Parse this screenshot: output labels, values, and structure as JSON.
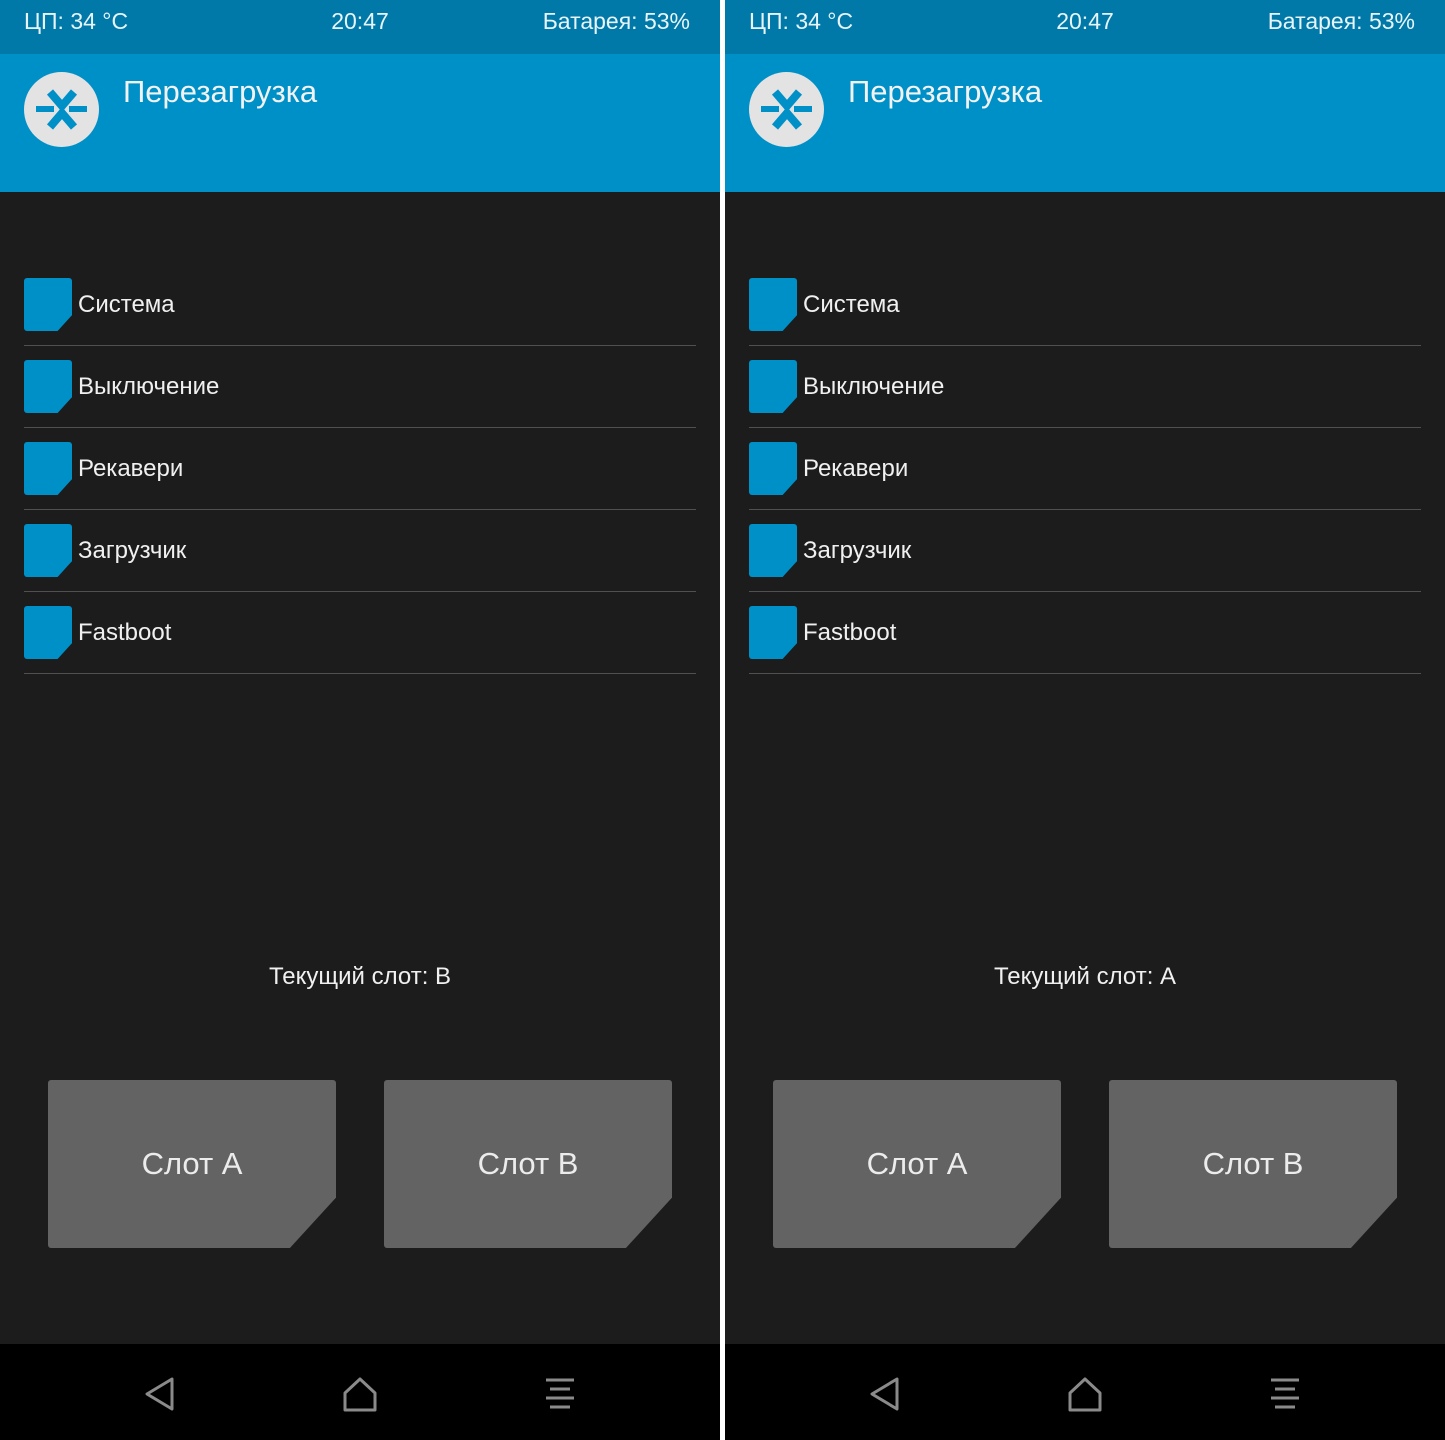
{
  "screens": [
    {
      "status": {
        "cpu": "ЦП: 34 °C",
        "time": "20:47",
        "battery": "Батарея: 53%"
      },
      "header": {
        "title": "Перезагрузка",
        "logo_icon": "twrp-logo-icon"
      },
      "menu": [
        {
          "label": "Система"
        },
        {
          "label": "Выключение"
        },
        {
          "label": "Рекавери"
        },
        {
          "label": "Загрузчик"
        },
        {
          "label": "Fastboot"
        }
      ],
      "current_slot": "Текущий слот: B",
      "slot_buttons": {
        "a": "Слот A",
        "b": "Слот B"
      },
      "nav": {
        "back_icon": "back-icon",
        "home_icon": "home-icon",
        "menu_icon": "menu-icon"
      }
    },
    {
      "status": {
        "cpu": "ЦП: 34 °C",
        "time": "20:47",
        "battery": "Батарея: 53%"
      },
      "header": {
        "title": "Перезагрузка",
        "logo_icon": "twrp-logo-icon"
      },
      "menu": [
        {
          "label": "Система"
        },
        {
          "label": "Выключение"
        },
        {
          "label": "Рекавери"
        },
        {
          "label": "Загрузчик"
        },
        {
          "label": "Fastboot"
        }
      ],
      "current_slot": "Текущий слот: A",
      "slot_buttons": {
        "a": "Слот A",
        "b": "Слот B"
      },
      "nav": {
        "back_icon": "back-icon",
        "home_icon": "home-icon",
        "menu_icon": "menu-icon"
      }
    }
  ],
  "colors": {
    "status_bar": "#0079a8",
    "header": "#0090c8",
    "accent": "#0090c8",
    "background": "#1c1c1c",
    "button": "#636363",
    "navbar": "#000000",
    "divider": "#505050"
  }
}
